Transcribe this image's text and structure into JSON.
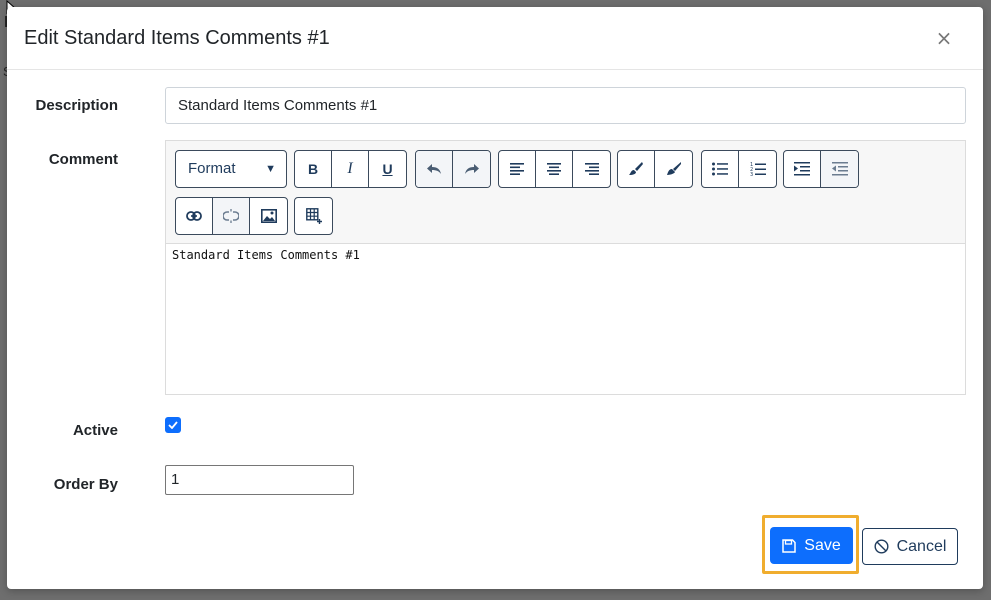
{
  "modal": {
    "title": "Edit Standard Items Comments #1",
    "close_label": "×"
  },
  "form": {
    "description": {
      "label": "Description",
      "value": "Standard Items Comments #1"
    },
    "comment": {
      "label": "Comment",
      "format_label": "Format",
      "content": "Standard Items Comments #1",
      "toolbar_icons": {
        "bold": "B",
        "italic": "I",
        "underline": "U"
      }
    },
    "active": {
      "label": "Active",
      "checked": true
    },
    "order_by": {
      "label": "Order By",
      "value": "1"
    }
  },
  "actions": {
    "save_label": "Save",
    "cancel_label": "Cancel"
  },
  "colors": {
    "primary": "#0d6efd",
    "focus_ring": "#f0ad2e",
    "toolbar_text": "#1f3b5c"
  }
}
